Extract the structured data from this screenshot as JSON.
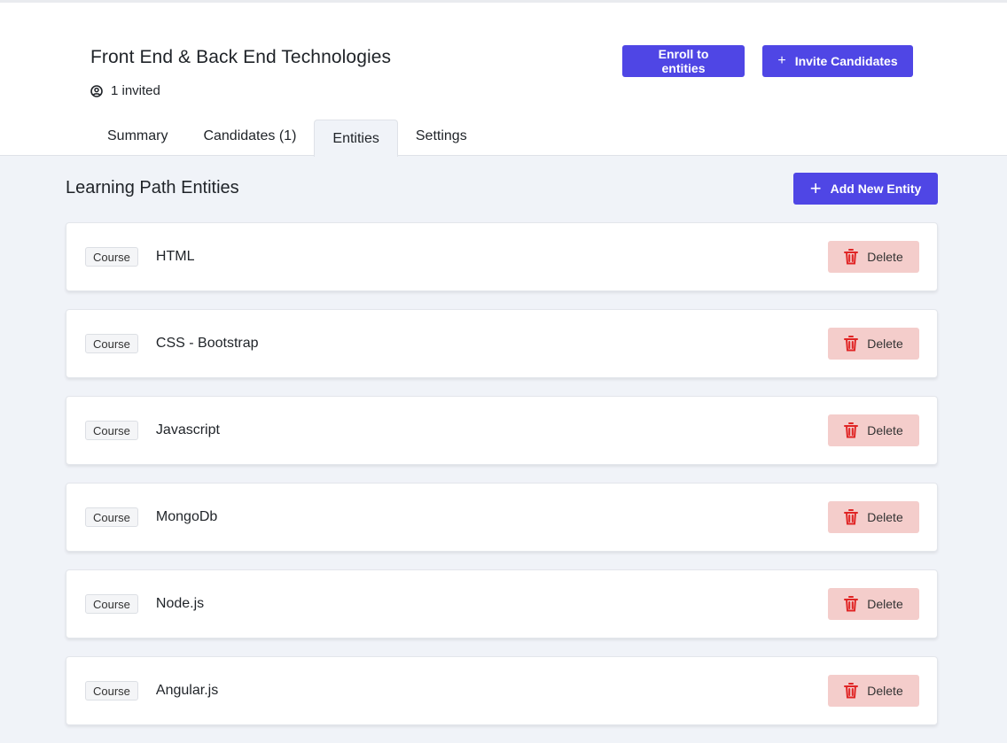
{
  "header": {
    "title": "Front End & Back End Technologies",
    "invited_text": "1 invited",
    "enroll_label": "Enroll to entities",
    "invite_label": "Invite Candidates"
  },
  "tabs": [
    {
      "label": "Summary",
      "active": false
    },
    {
      "label": "Candidates (1)",
      "active": false
    },
    {
      "label": "Entities",
      "active": true
    },
    {
      "label": "Settings",
      "active": false
    }
  ],
  "main": {
    "section_title": "Learning Path Entities",
    "add_label": "Add New Entity",
    "delete_label": "Delete",
    "entities": [
      {
        "type": "Course",
        "name": "HTML"
      },
      {
        "type": "Course",
        "name": "CSS - Bootstrap"
      },
      {
        "type": "Course",
        "name": "Javascript"
      },
      {
        "type": "Course",
        "name": "MongoDb"
      },
      {
        "type": "Course",
        "name": "Node.js"
      },
      {
        "type": "Course",
        "name": "Angular.js"
      }
    ]
  },
  "colors": {
    "primary": "#4f46e5",
    "delete_bg": "#f4cdcb",
    "delete_icon": "#e02424",
    "page_bg": "#f0f3f8"
  },
  "icons": {
    "invited": "user-circle-icon",
    "plus": "plus-icon",
    "delete": "trash-icon"
  }
}
